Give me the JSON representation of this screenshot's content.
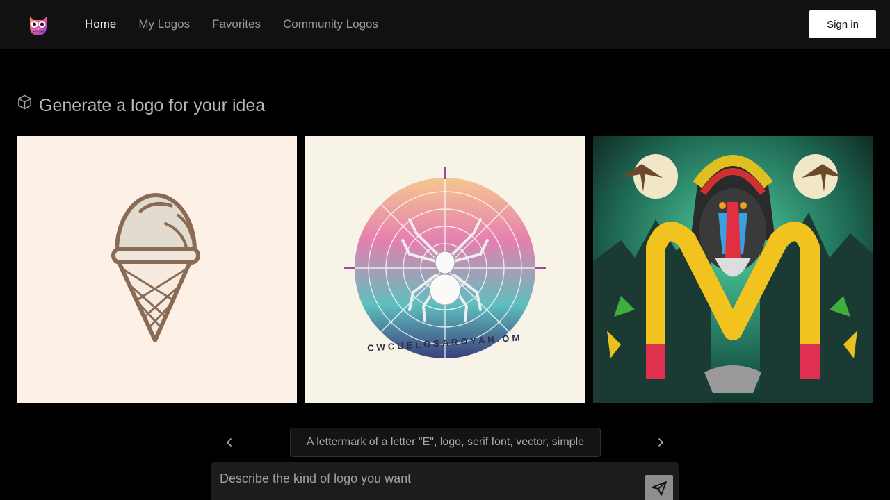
{
  "nav": {
    "links": [
      {
        "label": "Home",
        "active": true
      },
      {
        "label": "My Logos"
      },
      {
        "label": "Favorites"
      },
      {
        "label": "Community Logos"
      }
    ],
    "signin_label": "Sign in",
    "logo_icon": "owl-logo-icon"
  },
  "main": {
    "heading": "Generate a logo for your idea",
    "heading_icon": "cube-icon",
    "gallery": [
      {
        "subject": "ice-cream-cone-logo"
      },
      {
        "subject": "spider-web-logo",
        "caption_text": "CWCUELOSAROYAN.OM"
      },
      {
        "subject": "mandrill-letter-m-logo"
      }
    ],
    "suggestion": "A lettermark of a letter \"E\", logo, serif font, vector, simple",
    "prev_icon": "chevron-left-icon",
    "next_icon": "chevron-right-icon",
    "prompt": {
      "placeholder": "Describe the kind of logo you want",
      "value": ""
    },
    "send_icon": "send-icon"
  },
  "colors": {
    "background": "#000000",
    "navbar": "#111111",
    "signin_bg": "#ffffff",
    "send_button": "#8e8e8e"
  }
}
